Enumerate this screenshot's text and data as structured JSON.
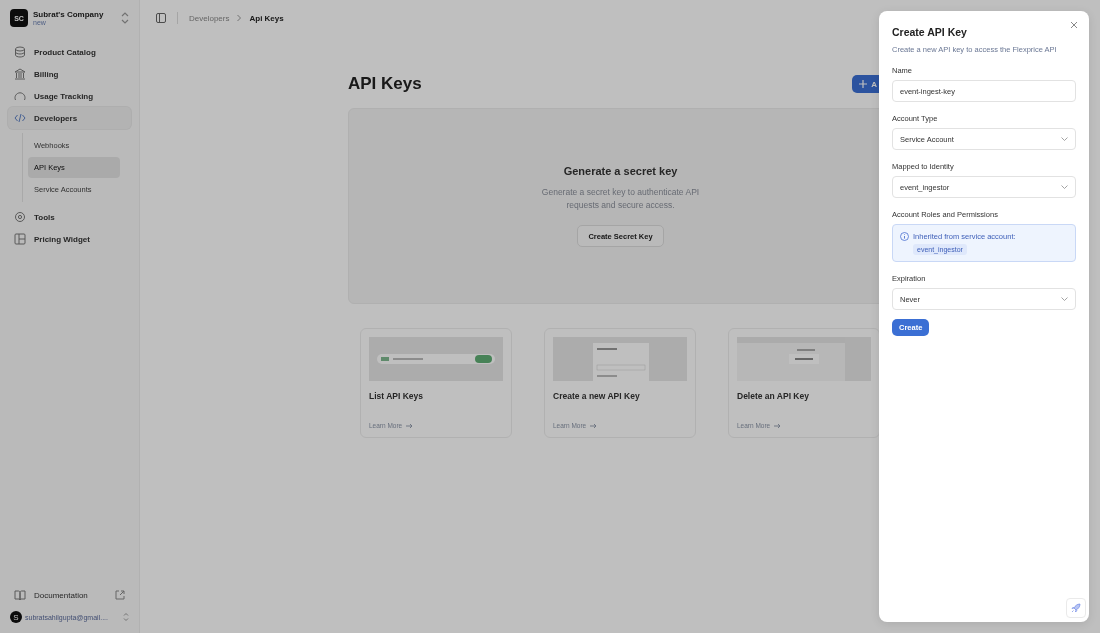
{
  "sidebar": {
    "company": {
      "initials": "SC",
      "name": "Subrat's Company",
      "badge": "new"
    },
    "items": [
      {
        "label": "Product Catalog",
        "selected": false
      },
      {
        "label": "Billing",
        "selected": false
      },
      {
        "label": "Usage Tracking",
        "selected": false
      },
      {
        "label": "Developers",
        "selected": true,
        "children": [
          {
            "label": "Webhooks",
            "selected": false
          },
          {
            "label": "API Keys",
            "selected": true
          },
          {
            "label": "Service Accounts",
            "selected": false
          }
        ]
      },
      {
        "label": "Tools",
        "selected": false
      },
      {
        "label": "Pricing Widget",
        "selected": false
      }
    ],
    "documentation": "Documentation",
    "user": {
      "initial": "S",
      "email": "subratsahilgupta@gmail...."
    }
  },
  "breadcrumb": [
    "Developers",
    "Api Keys"
  ],
  "page": {
    "title": "API Keys",
    "add_button": "A",
    "empty_state": {
      "title": "Generate a secret key",
      "text": "Generate a secret key to authenticate API requests and secure access.",
      "button": "Create Secret Key"
    },
    "cards": [
      {
        "title": "List API Keys",
        "link": "Learn More",
        "kind": "list"
      },
      {
        "title": "Create a new API Key",
        "link": "Learn More",
        "kind": "create"
      },
      {
        "title": "Delete an API Key",
        "link": "Learn More",
        "kind": "delete"
      }
    ]
  },
  "dialog": {
    "title": "Create API Key",
    "subtitle": "Create a new API key to access the Flexprice API",
    "fields": [
      {
        "label": "Name",
        "kind": "input",
        "value": "event-ingest-key"
      },
      {
        "label": "Account Type",
        "kind": "select",
        "value": "Service Account"
      },
      {
        "label": "Mapped to Identity",
        "kind": "select",
        "value": "event_ingestor"
      },
      {
        "label": "Account Roles and Permissions",
        "kind": "info",
        "value": "Inherited from service account:",
        "tag": "event_ingestor"
      },
      {
        "label": "Expiration",
        "kind": "select",
        "value": "Never"
      }
    ],
    "button": "Create"
  }
}
